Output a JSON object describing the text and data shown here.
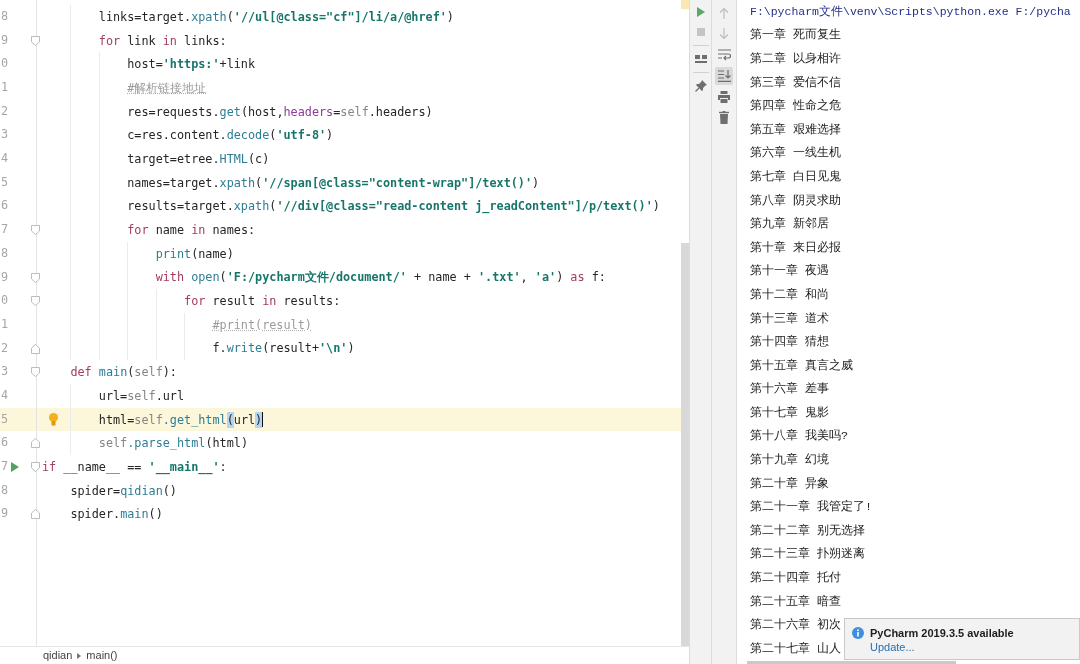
{
  "editor": {
    "lines": [
      {
        "children": [
          {
            "children": [
              {
                "number": "8",
                "current": false,
                "bulb": false,
                "run": false,
                "tokens": [
                  {
                    "text": "links=target.",
                    "kind": "plain"
                  },
                  {
                    "text": "xpath",
                    "kind": "call"
                  },
                  {
                    "text": "(",
                    "kind": "plain"
                  },
                  {
                    "text": "'//ul[@class=\"cf\"]/li/a/@href'",
                    "kind": "string"
                  },
                  {
                    "text": ")",
                    "kind": "plain"
                  }
                ]
              },
              {
                "number": "9",
                "current": false,
                "bulb": false,
                "run": false,
                "tokens": [
                  {
                    "text": "for",
                    "kind": "keyword"
                  },
                  {
                    "text": " link ",
                    "kind": "plain"
                  },
                  {
                    "text": "in",
                    "kind": "keyword"
                  },
                  {
                    "text": " links:",
                    "kind": "plain"
                  }
                ],
                "children": [
                  {
                    "number": "0",
                    "current": false,
                    "bulb": false,
                    "run": false,
                    "tokens": [
                      {
                        "text": "host=",
                        "kind": "plain"
                      },
                      {
                        "text": "'https:'",
                        "kind": "string"
                      },
                      {
                        "text": "+link",
                        "kind": "plain"
                      }
                    ]
                  },
                  {
                    "number": "1",
                    "current": false,
                    "bulb": false,
                    "run": false,
                    "tokens": [
                      {
                        "text": "#解析链接地址",
                        "kind": "comment"
                      }
                    ]
                  },
                  {
                    "number": "2",
                    "current": false,
                    "bulb": false,
                    "run": false,
                    "tokens": [
                      {
                        "text": "res=requests.",
                        "kind": "plain"
                      },
                      {
                        "text": "get",
                        "kind": "call"
                      },
                      {
                        "text": "(host,",
                        "kind": "plain"
                      },
                      {
                        "text": "headers",
                        "kind": "kwarg"
                      },
                      {
                        "text": "=",
                        "kind": "plain"
                      },
                      {
                        "text": "self",
                        "kind": "self"
                      },
                      {
                        "text": ".headers)",
                        "kind": "plain"
                      }
                    ]
                  },
                  {
                    "number": "3",
                    "current": false,
                    "bulb": false,
                    "run": false,
                    "tokens": [
                      {
                        "text": "c=res.content.",
                        "kind": "plain"
                      },
                      {
                        "text": "decode",
                        "kind": "call"
                      },
                      {
                        "text": "(",
                        "kind": "plain"
                      },
                      {
                        "text": "'utf-8'",
                        "kind": "string"
                      },
                      {
                        "text": ")",
                        "kind": "plain"
                      }
                    ]
                  },
                  {
                    "number": "4",
                    "current": false,
                    "bulb": false,
                    "run": false,
                    "tokens": [
                      {
                        "text": "target=etree.",
                        "kind": "plain"
                      },
                      {
                        "text": "HTML",
                        "kind": "call"
                      },
                      {
                        "text": "(c)",
                        "kind": "plain"
                      }
                    ]
                  },
                  {
                    "number": "5",
                    "current": false,
                    "bulb": false,
                    "run": false,
                    "tokens": [
                      {
                        "text": "names=target.",
                        "kind": "plain"
                      },
                      {
                        "text": "xpath",
                        "kind": "call"
                      },
                      {
                        "text": "(",
                        "kind": "plain"
                      },
                      {
                        "text": "'//span[@class=\"content-wrap\"]/text()'",
                        "kind": "string"
                      },
                      {
                        "text": ")",
                        "kind": "plain"
                      }
                    ]
                  },
                  {
                    "number": "6",
                    "current": false,
                    "bulb": false,
                    "run": false,
                    "tokens": [
                      {
                        "text": "results=target.",
                        "kind": "plain"
                      },
                      {
                        "text": "xpath",
                        "kind": "call"
                      },
                      {
                        "text": "(",
                        "kind": "plain"
                      },
                      {
                        "text": "'//div[@class=\"read-content j_readContent\"]/p/text()'",
                        "kind": "string"
                      },
                      {
                        "text": ")",
                        "kind": "plain"
                      }
                    ]
                  },
                  {
                    "number": "7",
                    "current": false,
                    "bulb": false,
                    "run": false,
                    "tokens": [
                      {
                        "text": "for",
                        "kind": "keyword"
                      },
                      {
                        "text": " name ",
                        "kind": "plain"
                      },
                      {
                        "text": "in",
                        "kind": "keyword"
                      },
                      {
                        "text": " names:",
                        "kind": "plain"
                      }
                    ],
                    "children": [
                      {
                        "number": "8",
                        "current": false,
                        "bulb": false,
                        "run": false,
                        "tokens": [
                          {
                            "text": "print",
                            "kind": "call"
                          },
                          {
                            "text": "(name)",
                            "kind": "plain"
                          }
                        ]
                      },
                      {
                        "number": "9",
                        "current": false,
                        "bulb": false,
                        "run": false,
                        "tokens": [
                          {
                            "text": "with",
                            "kind": "keyword"
                          },
                          {
                            "text": " open",
                            "kind": "call"
                          },
                          {
                            "text": "(",
                            "kind": "plain"
                          },
                          {
                            "text": "'F:/pycharm文件/document/'",
                            "kind": "string"
                          },
                          {
                            "text": " + name + ",
                            "kind": "plain"
                          },
                          {
                            "text": "'.txt'",
                            "kind": "string"
                          },
                          {
                            "text": ", ",
                            "kind": "plain"
                          },
                          {
                            "text": "'a'",
                            "kind": "string"
                          },
                          {
                            "text": ") ",
                            "kind": "plain"
                          },
                          {
                            "text": "as",
                            "kind": "keyword"
                          },
                          {
                            "text": " f:",
                            "kind": "plain"
                          }
                        ],
                        "children": [
                          {
                            "number": "0",
                            "current": false,
                            "bulb": false,
                            "run": false,
                            "tokens": [
                              {
                                "text": "for",
                                "kind": "keyword"
                              },
                              {
                                "text": " result ",
                                "kind": "plain"
                              },
                              {
                                "text": "in",
                                "kind": "keyword"
                              },
                              {
                                "text": " results:",
                                "kind": "plain"
                              }
                            ],
                            "children": [
                              {
                                "number": "1",
                                "current": false,
                                "bulb": false,
                                "run": false,
                                "tokens": [
                                  {
                                    "text": "#print(result)",
                                    "kind": "comment"
                                  }
                                ]
                              },
                              {
                                "number": "2",
                                "current": false,
                                "bulb": false,
                                "run": false,
                                "tokens": [
                                  {
                                    "text": "f.",
                                    "kind": "plain"
                                  },
                                  {
                                    "text": "write",
                                    "kind": "call"
                                  },
                                  {
                                    "text": "(result+",
                                    "kind": "plain"
                                  },
                                  {
                                    "text": "'\\n'",
                                    "kind": "string"
                                  },
                                  {
                                    "text": ")",
                                    "kind": "plain"
                                  }
                                ]
                              }
                            ]
                          }
                        ]
                      }
                    ]
                  }
                ]
              }
            ]
          },
          {
            "number": "3",
            "current": false,
            "bulb": false,
            "run": false,
            "tokens": [
              {
                "text": "def",
                "kind": "keyword"
              },
              {
                "text": " main",
                "kind": "call"
              },
              {
                "text": "(",
                "kind": "plain"
              },
              {
                "text": "self",
                "kind": "self"
              },
              {
                "text": "):",
                "kind": "plain"
              }
            ],
            "children": [
              {
                "number": "4",
                "current": false,
                "bulb": false,
                "run": false,
                "tokens": [
                  {
                    "text": "url=",
                    "kind": "plain"
                  },
                  {
                    "text": "self",
                    "kind": "self"
                  },
                  {
                    "text": ".url",
                    "kind": "plain"
                  }
                ]
              },
              {
                "number": "5",
                "current": true,
                "bulb": true,
                "run": false,
                "tokens": [
                  {
                    "text": "html=",
                    "kind": "plain"
                  },
                  {
                    "text": "self",
                    "kind": "self"
                  },
                  {
                    "text": ".get_html",
                    "kind": "call"
                  },
                  {
                    "text": "(",
                    "kind": "bracket_match"
                  },
                  {
                    "text": "url",
                    "kind": "plain"
                  },
                  {
                    "text": ")",
                    "kind": "bracket_match"
                  }
                ]
              },
              {
                "number": "6",
                "current": false,
                "bulb": false,
                "run": false,
                "tokens": [
                  {
                    "text": "self",
                    "kind": "self"
                  },
                  {
                    "text": ".parse_html",
                    "kind": "call"
                  },
                  {
                    "text": "(html)",
                    "kind": "plain"
                  }
                ]
              }
            ]
          }
        ]
      },
      {
        "number": "7",
        "current": false,
        "bulb": false,
        "run": true,
        "tokens": [
          {
            "text": "if",
            "kind": "keyword"
          },
          {
            "text": " __name__ == ",
            "kind": "plain"
          },
          {
            "text": "'__main__'",
            "kind": "string"
          },
          {
            "text": ":",
            "kind": "plain"
          }
        ],
        "children": [
          {
            "number": "8",
            "current": false,
            "bulb": false,
            "run": false,
            "tokens": [
              {
                "text": "spider=",
                "kind": "plain"
              },
              {
                "text": "qidian",
                "kind": "call"
              },
              {
                "text": "()",
                "kind": "plain"
              }
            ]
          },
          {
            "number": "9",
            "current": false,
            "bulb": false,
            "run": false,
            "tokens": [
              {
                "text": "spider.",
                "kind": "plain"
              },
              {
                "text": "main",
                "kind": "call"
              },
              {
                "text": "()",
                "kind": "plain"
              }
            ]
          }
        ]
      }
    ],
    "breadcrumbs": [
      "qidian",
      "main()"
    ]
  },
  "run_panel": {
    "toolbar_left": [
      [
        {
          "kind": "run",
          "disabled": false,
          "on": false
        },
        {
          "kind": "stop",
          "disabled": true,
          "on": false
        }
      ],
      [
        {
          "kind": "layout",
          "disabled": false,
          "on": false
        }
      ],
      [
        {
          "kind": "pin",
          "disabled": false,
          "on": false
        }
      ]
    ],
    "toolbar_right": [
      {
        "kind": "up",
        "disabled": true,
        "on": false
      },
      {
        "kind": "down",
        "disabled": true,
        "on": false
      },
      {
        "kind": "soft_wrap",
        "disabled": false,
        "on": false
      },
      {
        "kind": "scroll_to_end",
        "disabled": false,
        "on": true
      },
      {
        "kind": "print",
        "disabled": false,
        "on": false
      },
      {
        "kind": "clear",
        "disabled": false,
        "on": false
      }
    ],
    "command": "F:\\pycharm文件\\venv\\Scripts\\python.exe F:/pycha",
    "output": [
      "第一章 死而复生",
      "第二章 以身相许",
      "第三章 爱信不信",
      "第四章 性命之危",
      "第五章 艰难选择",
      "第六章 一线生机",
      "第七章 白日见鬼",
      "第八章 阴灵求助",
      "第九章 新邻居",
      "第十章 来日必报",
      "第十一章 夜遇",
      "第十二章 和尚",
      "第十三章 道术",
      "第十四章 猜想",
      "第十五章 真言之威",
      "第十六章 差事",
      "第十七章 鬼影",
      "第十八章 我美吗?",
      "第十九章 幻境",
      "第二十章 异象",
      "第二十一章 我管定了!",
      "第二十二章 别无选择",
      "第二十三章 扑朔迷离",
      "第二十四章 托付",
      "第二十五章 暗查",
      "第二十六章 初次",
      "第二十七章 山人"
    ]
  },
  "notification": {
    "title": "PyCharm 2019.3.5 available",
    "link": "Update..."
  }
}
